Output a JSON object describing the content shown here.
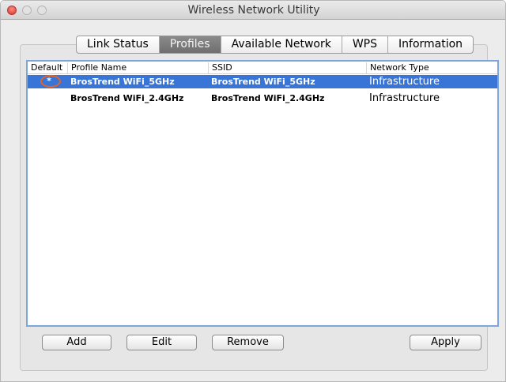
{
  "window": {
    "title": "Wireless Network Utility"
  },
  "tabs": [
    {
      "label": "Link Status",
      "active": false
    },
    {
      "label": "Profiles",
      "active": true
    },
    {
      "label": "Available Network",
      "active": false
    },
    {
      "label": "WPS",
      "active": false
    },
    {
      "label": "Information",
      "active": false
    }
  ],
  "table": {
    "columns": [
      "Default",
      "Profile Name",
      "SSID",
      "Network Type"
    ],
    "rows": [
      {
        "default": "*",
        "profile_name": "BrosTrend WiFi_5GHz",
        "ssid": "BrosTrend WiFi_5GHz",
        "network_type": "Infrastructure",
        "selected": true
      },
      {
        "default": "",
        "profile_name": "BrosTrend WiFi_2.4GHz",
        "ssid": "BrosTrend WiFi_2.4GHz",
        "network_type": "Infrastructure",
        "selected": false
      }
    ]
  },
  "buttons": {
    "add": "Add",
    "edit": "Edit",
    "remove": "Remove",
    "apply": "Apply"
  },
  "colors": {
    "selection": "#3875d7",
    "default_marker": "#e2642e",
    "table_border": "#7ca7db"
  }
}
